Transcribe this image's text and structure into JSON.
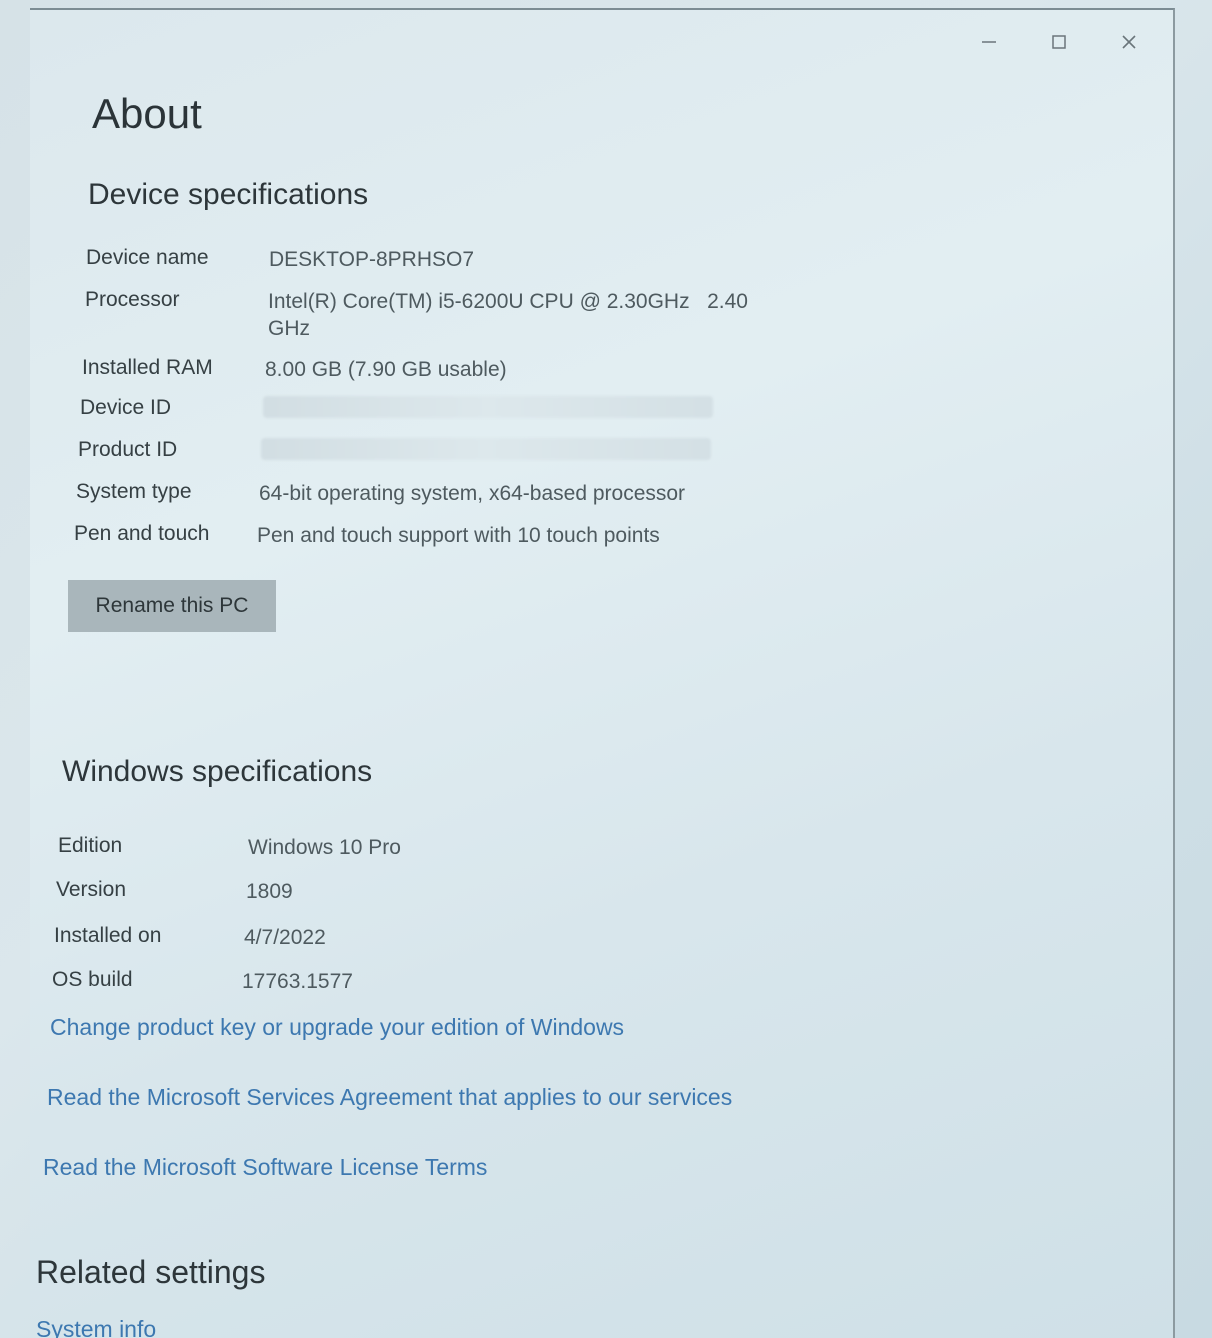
{
  "window": {
    "controls": {
      "minimize_icon": "minimize-icon",
      "maximize_icon": "maximize-icon",
      "close_icon": "close-icon"
    }
  },
  "page": {
    "title": "About"
  },
  "device_specs": {
    "heading": "Device specifications",
    "rows": [
      {
        "label": "Device name",
        "value": "DESKTOP-8PRHSO7"
      },
      {
        "label": "Processor",
        "value": "Intel(R) Core(TM) i5-6200U CPU @ 2.30GHz   2.40",
        "value_cont": "GHz"
      },
      {
        "label": "Installed RAM",
        "value": "8.00 GB (7.90 GB usable)"
      },
      {
        "label": "Device ID",
        "value": ""
      },
      {
        "label": "Product ID",
        "value": ""
      },
      {
        "label": "System type",
        "value": "64-bit operating system, x64-based processor"
      },
      {
        "label": "Pen and touch",
        "value": "Pen and touch support with 10 touch points"
      }
    ],
    "rename_button": "Rename this PC"
  },
  "windows_specs": {
    "heading": "Windows specifications",
    "rows": [
      {
        "label": "Edition",
        "value": "Windows 10 Pro"
      },
      {
        "label": "Version",
        "value": "1809"
      },
      {
        "label": "Installed on",
        "value": "4/7/2022"
      },
      {
        "label": "OS build",
        "value": "17763.1577"
      }
    ],
    "links": {
      "change_key": "Change product key or upgrade your edition of Windows",
      "services_agreement": "Read the Microsoft Services Agreement that applies to our services",
      "license_terms": "Read the Microsoft Software License Terms"
    }
  },
  "related": {
    "heading": "Related settings",
    "system_info": "System info"
  },
  "colors": {
    "link": "#3d78b0",
    "button_bg": "#a9b6bb",
    "background": "#dce8ed"
  }
}
